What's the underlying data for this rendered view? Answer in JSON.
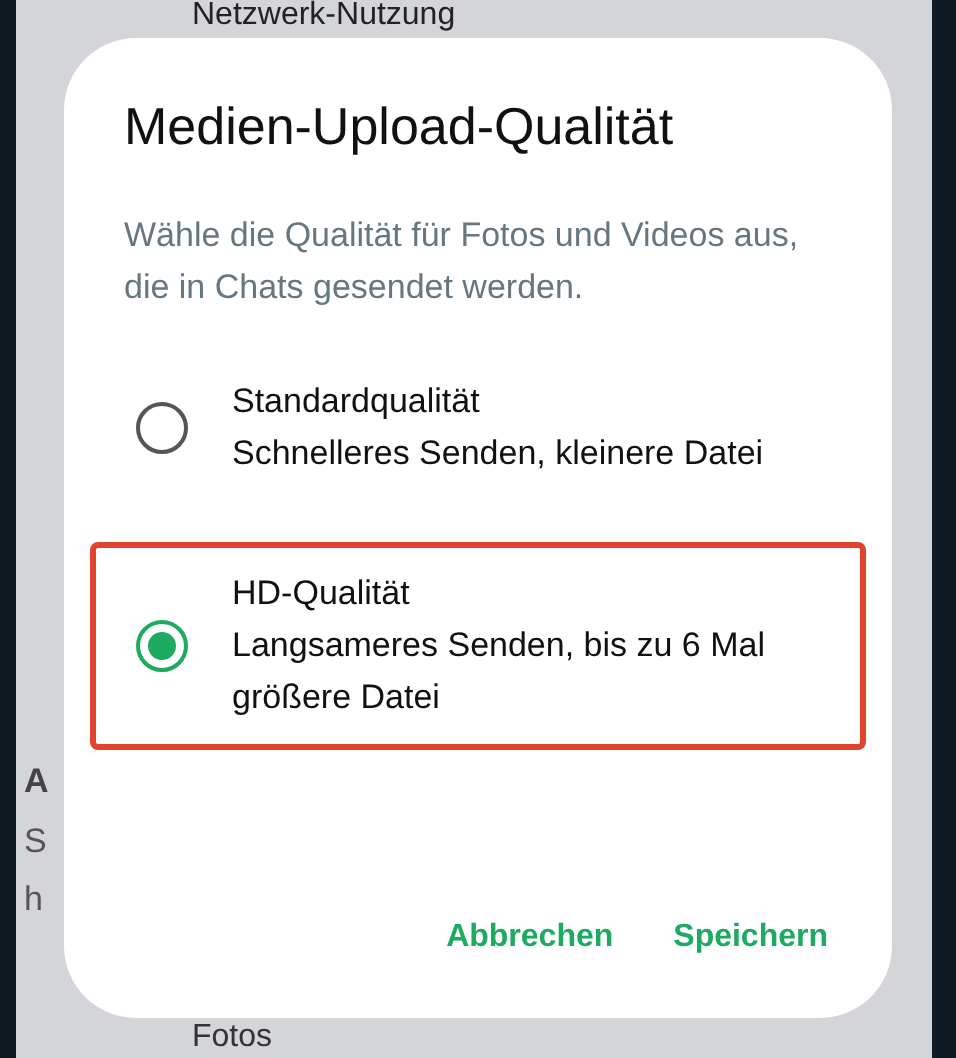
{
  "background": {
    "header": "Netzwerk-Nutzung",
    "side_letters": [
      "A",
      "S",
      "h"
    ],
    "footer": "Fotos"
  },
  "dialog": {
    "title": "Medien-Upload-Qualität",
    "description": "Wähle die Qualität für Fotos und Videos aus, die in Chats gesendet werden.",
    "options": [
      {
        "title": "Standardqualität",
        "subtitle": "Schnelleres Senden, kleinere Datei",
        "selected": false,
        "highlighted": false
      },
      {
        "title": "HD-Qualität",
        "subtitle": "Langsameres Senden, bis zu 6 Mal größere Datei",
        "selected": true,
        "highlighted": true
      }
    ],
    "buttons": [
      "Abbrechen",
      "Speichern"
    ]
  }
}
